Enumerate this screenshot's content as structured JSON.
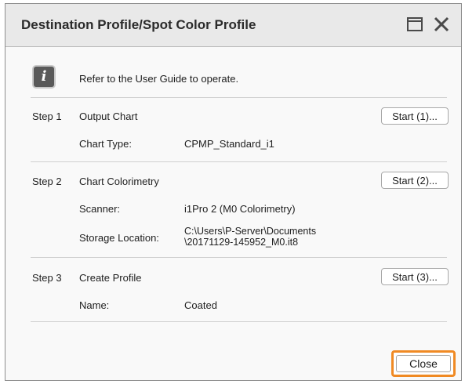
{
  "dialog": {
    "title": "Destination Profile/Spot Color Profile",
    "info_text": "Refer to the User Guide to operate.",
    "close_label": "Close"
  },
  "steps": [
    {
      "step": "Step 1",
      "name": "Output Chart",
      "button": "Start (1)...",
      "fields": [
        {
          "label": "Chart Type:",
          "value": "CPMP_Standard_i1"
        }
      ]
    },
    {
      "step": "Step 2",
      "name": "Chart Colorimetry",
      "button": "Start (2)...",
      "fields": [
        {
          "label": "Scanner:",
          "value": "i1Pro 2 (M0 Colorimetry)"
        },
        {
          "label": "Storage Location:",
          "value_line1": "C:\\Users\\P-Server\\Documents",
          "value_line2": "\\20171129-145952_M0.it8"
        }
      ]
    },
    {
      "step": "Step 3",
      "name": "Create Profile",
      "button": "Start (3)...",
      "fields": [
        {
          "label": "Name:",
          "value": "Coated"
        }
      ]
    }
  ],
  "icons": {
    "info": "info-icon",
    "window": "window-icon",
    "close": "close-icon"
  },
  "colors": {
    "highlight": "#f08a24",
    "titlebar": "#e9e9e9"
  }
}
